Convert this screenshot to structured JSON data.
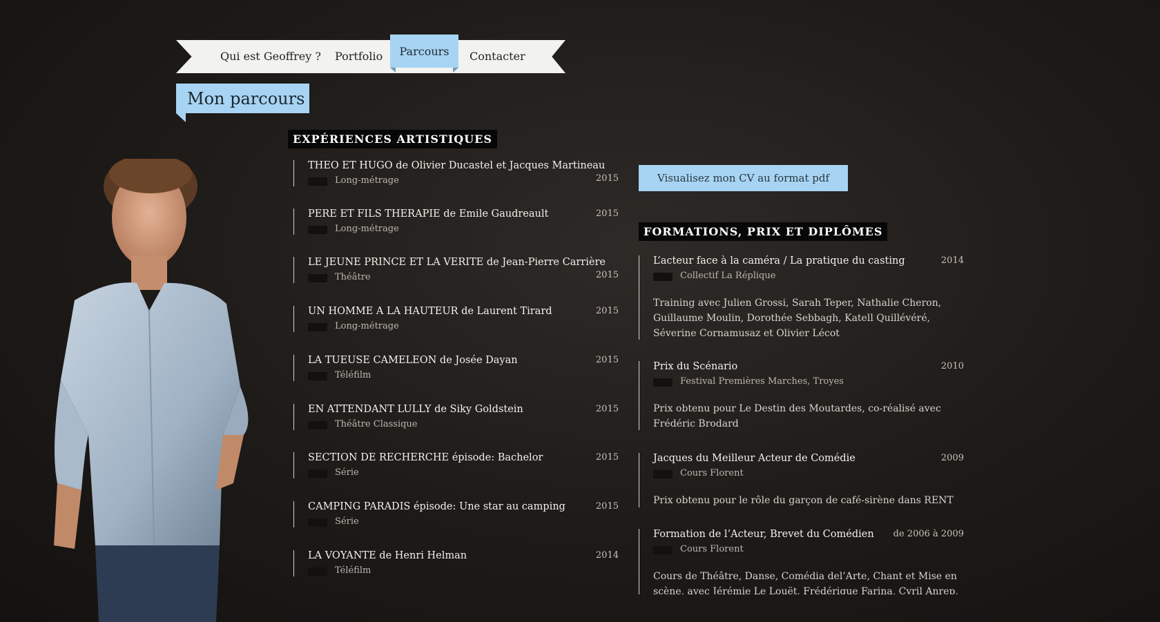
{
  "nav": {
    "items": [
      "Qui est Geoffrey ?",
      "Portfolio",
      "Parcours",
      "Contacter"
    ],
    "active": "Parcours"
  },
  "page": {
    "title": "Mon parcours"
  },
  "experiences": {
    "heading": "EXPÉRIENCES ARTISTIQUES",
    "items": [
      {
        "title": "THEO ET HUGO de Olivier Ducastel et Jacques Martineau",
        "category": "Long-métrage",
        "year": "2015"
      },
      {
        "title": "PERE ET FILS THERAPIE de Emile Gaudreault",
        "category": "Long-métrage",
        "year": "2015"
      },
      {
        "title": "LE JEUNE PRINCE ET LA VERITE de Jean-Pierre Carrière",
        "category": "Théâtre",
        "year": "2015"
      },
      {
        "title": "UN HOMME A LA HAUTEUR de Laurent Tirard",
        "category": "Long-métrage",
        "year": "2015"
      },
      {
        "title": "LA TUEUSE CAMELEON de Josée Dayan",
        "category": "Téléfilm",
        "year": "2015"
      },
      {
        "title": "EN ATTENDANT LULLY de Siky Goldstein",
        "category": "Théâtre Classique",
        "year": "2015"
      },
      {
        "title": "SECTION DE RECHERCHE épisode: Bachelor",
        "category": "Série",
        "year": "2015"
      },
      {
        "title": "CAMPING PARADIS épisode: Une star au camping",
        "category": "Série",
        "year": "2015"
      },
      {
        "title": "LA VOYANTE de Henri Helman",
        "category": "Téléfilm",
        "year": "2014"
      }
    ]
  },
  "cv": {
    "button_label": "Visualisez mon CV au format pdf"
  },
  "formations": {
    "heading": "FORMATIONS, PRIX ET DIPLÔMES",
    "items": [
      {
        "title": "L’acteur face à la caméra / La pratique du casting",
        "org": "Collectif La Réplique",
        "year": "2014",
        "description": "Training avec Julien Grossi, Sarah Teper, Nathalie Cheron, Guillaume Moulin, Dorothée Sebbagh, Katell Quillévéré, Séverine Cornamusaz et Olivier Lécot"
      },
      {
        "title": "Prix du Scénario",
        "org": "Festival Premières Marches, Troyes",
        "year": "2010",
        "description": "Prix obtenu pour Le Destin des Moutardes, co-réalisé avec Frédéric Brodard"
      },
      {
        "title": "Jacques du Meilleur Acteur de Comédie",
        "org": "Cours Florent",
        "year": "2009",
        "description": "Prix obtenu pour le rôle du garçon de café-sirène dans RENT"
      },
      {
        "title": "Formation de l’Acteur, Brevet du Comédien",
        "org": "Cours Florent",
        "year": "de 2006 à 2009",
        "description": "Cours de Théâtre, Danse, Comédia del’Arte, Chant et Mise en scène, avec Jérémie Le Louët, Frédérique Farina, Cyril Anrep, Michel"
      }
    ]
  }
}
